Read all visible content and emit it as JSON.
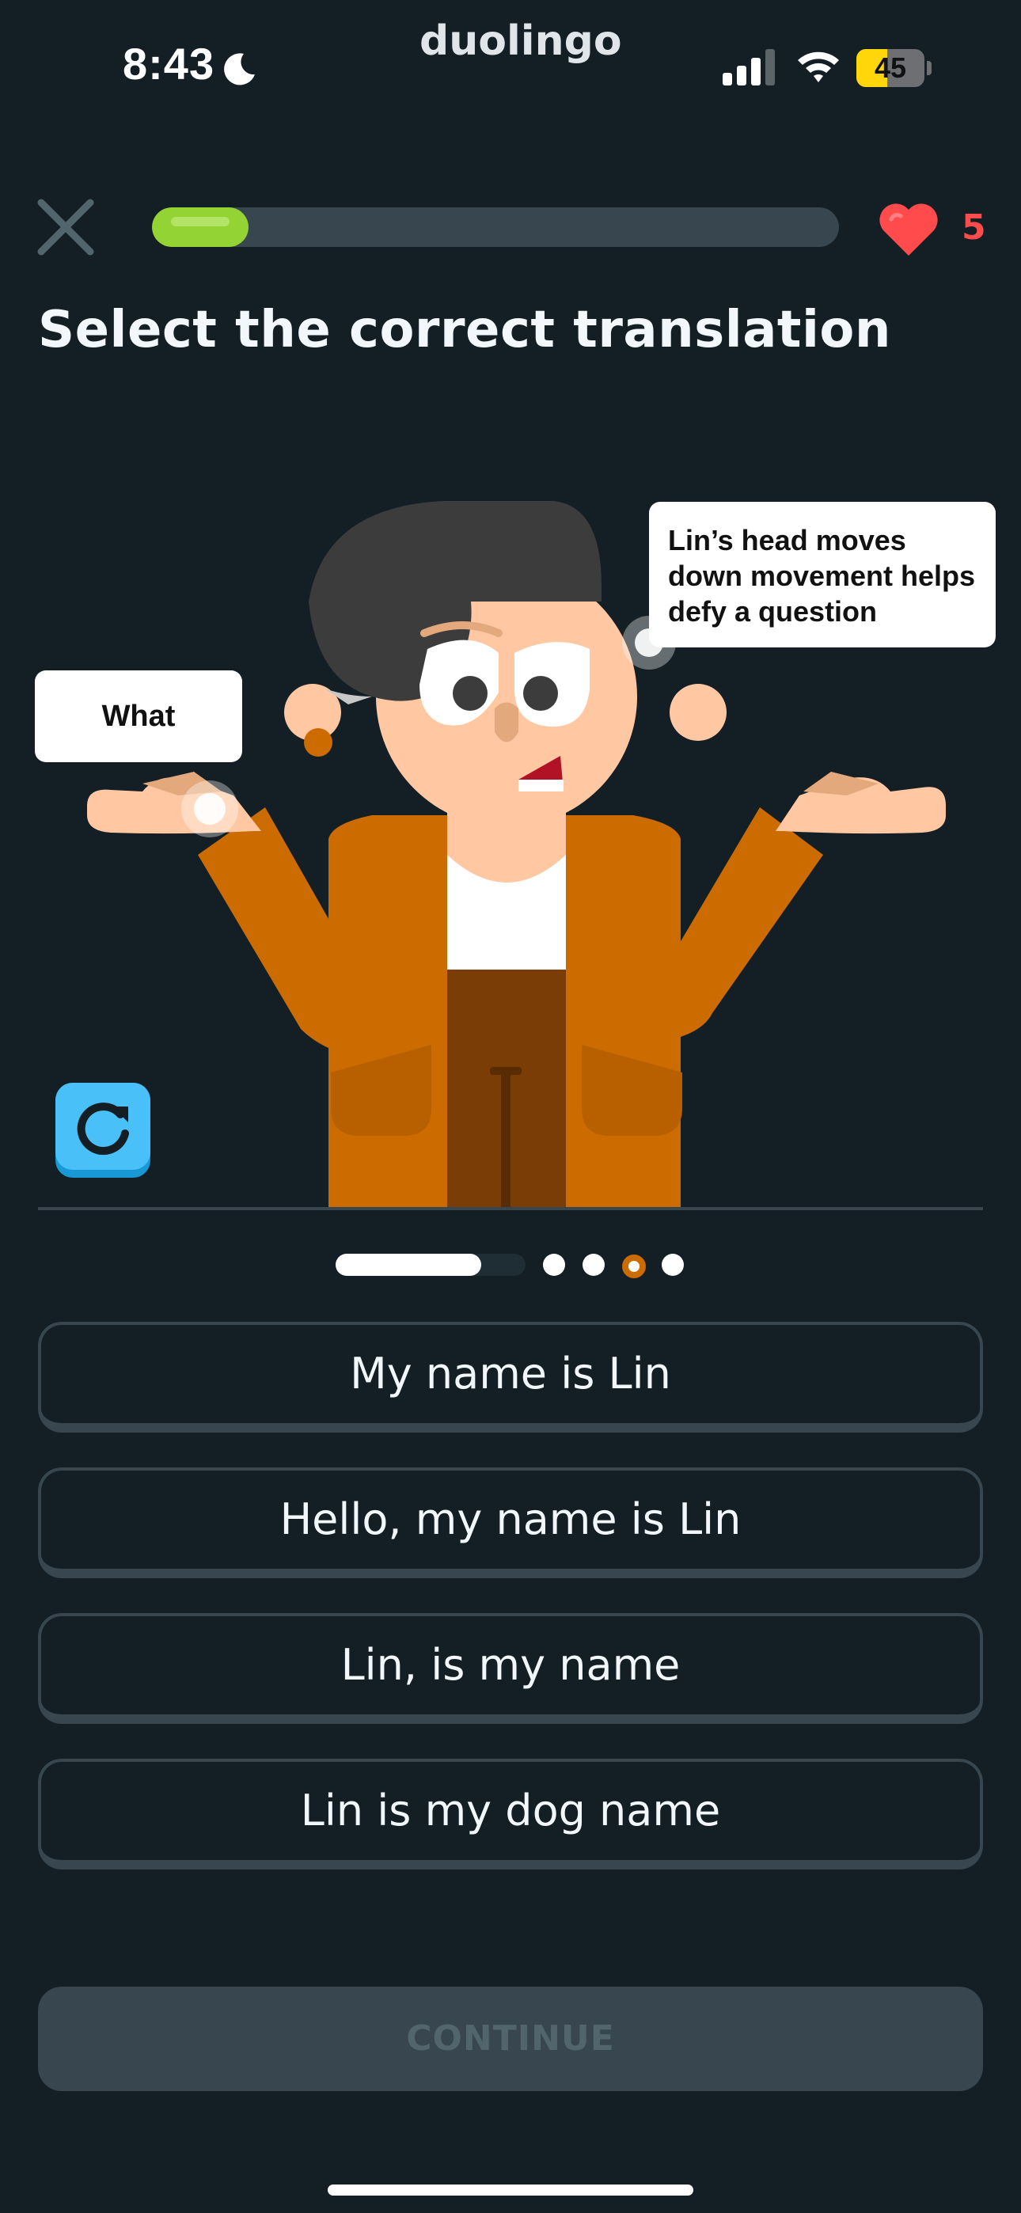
{
  "status_bar": {
    "time": "8:43",
    "carrier_logo": "duolingo",
    "battery_percent": "45",
    "battery_level": 0.45,
    "icons": [
      "moon-icon",
      "signal-icon",
      "wifi-icon",
      "battery-icon"
    ]
  },
  "lesson": {
    "progress_fraction": 0.14,
    "hearts": "5",
    "instruction": "Select the correct translation"
  },
  "scene": {
    "bubble_left": "What",
    "bubble_right": "Lin’s head moves down movement helps defy a question",
    "replay_icon": "replay-icon"
  },
  "pager": {
    "dots": 4,
    "active_dot": 3
  },
  "options": [
    {
      "label": "My name is Lin"
    },
    {
      "label": "Hello, my name is Lin"
    },
    {
      "label": "Lin, is my name"
    },
    {
      "label": "Lin is my dog name"
    }
  ],
  "footer": {
    "continue_label": "CONTINUE"
  },
  "colors": {
    "background": "#131f24",
    "progress_green": "#93d333",
    "heart_red": "#ff4b4b",
    "replay_blue": "#49c0f8",
    "jacket_orange": "#cc6b00",
    "skin": "#ffc8a3",
    "border_gray": "#37464f"
  }
}
